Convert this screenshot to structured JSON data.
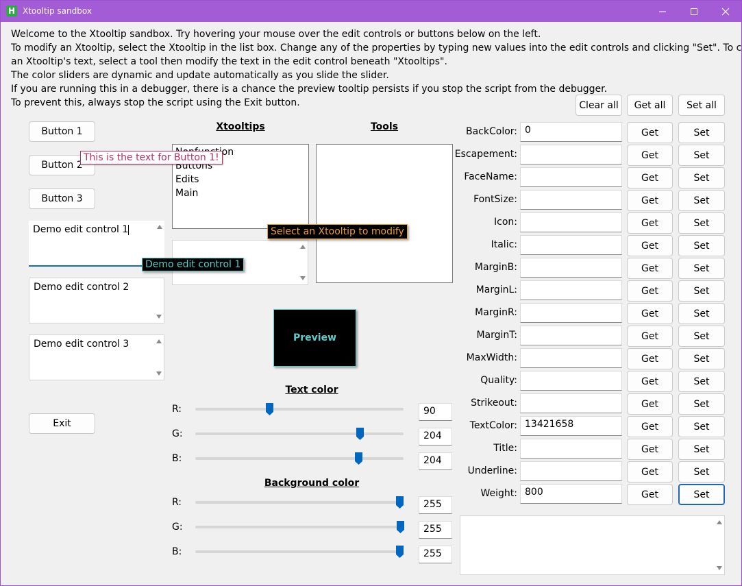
{
  "window": {
    "title": "Xtooltip sandbox",
    "icon_letter": "H",
    "accent": "#a35bd6"
  },
  "intro_lines": [
    "Welcome to the Xtooltip sandbox. Try hovering your mouse over the edit controls or buttons below on the left.",
    "To modify an Xtooltip, select the Xtooltip in the list box. Change any of the properties by typing new values into the edit controls and clicking \"Set\". To change",
    "an Xtooltip's text, select a tool then modify the text in the edit control beneath \"Xtooltips\".",
    "The color sliders are dynamic and update automatically as you slide the slider.",
    "If you are running this in a debugger, there is a chance the preview tooltip persists if you stop the script from the debugger.",
    "To prevent this, always stop the script using the Exit button."
  ],
  "top_buttons": {
    "clear_all": "Clear all",
    "get_all": "Get all",
    "set_all": "Set all"
  },
  "left": {
    "button1": "Button 1",
    "button2": "Button 2",
    "button3": "Button 3",
    "edit1": "Demo edit control 1",
    "edit2": "Demo edit control 2",
    "edit3": "Demo edit control 3",
    "exit": "Exit"
  },
  "tooltips": {
    "button1": "This is the text for Button 1!",
    "edit1": "Demo edit control 1",
    "select": "Select an Xtooltip to modify"
  },
  "xtooltips": {
    "heading": "Xtooltips",
    "items": [
      "Nonfunction",
      "Buttons",
      "Edits",
      "Main"
    ]
  },
  "tools": {
    "heading": "Tools"
  },
  "preview": {
    "label": "Preview",
    "text_color": "#5acccc"
  },
  "text_color": {
    "heading": "Text color",
    "r_label": "R:",
    "g_label": "G:",
    "b_label": "B:",
    "r": "90",
    "g": "204",
    "b": "204"
  },
  "background_color": {
    "heading": "Background color",
    "r_label": "R:",
    "g_label": "G:",
    "b_label": "B:",
    "r": "255",
    "g": "255",
    "b": "255"
  },
  "properties": [
    {
      "label": "BackColor:",
      "value": "0"
    },
    {
      "label": "Escapement:",
      "value": ""
    },
    {
      "label": "FaceName:",
      "value": ""
    },
    {
      "label": "FontSize:",
      "value": ""
    },
    {
      "label": "Icon:",
      "value": ""
    },
    {
      "label": "Italic:",
      "value": ""
    },
    {
      "label": "MarginB:",
      "value": ""
    },
    {
      "label": "MarginL:",
      "value": ""
    },
    {
      "label": "MarginR:",
      "value": ""
    },
    {
      "label": "MarginT:",
      "value": ""
    },
    {
      "label": "MaxWidth:",
      "value": ""
    },
    {
      "label": "Quality:",
      "value": ""
    },
    {
      "label": "Strikeout:",
      "value": ""
    },
    {
      "label": "TextColor:",
      "value": "13421658"
    },
    {
      "label": "Title:",
      "value": ""
    },
    {
      "label": "Underline:",
      "value": ""
    },
    {
      "label": "Weight:",
      "value": "800"
    }
  ],
  "row_buttons": {
    "get": "Get",
    "set": "Set"
  }
}
